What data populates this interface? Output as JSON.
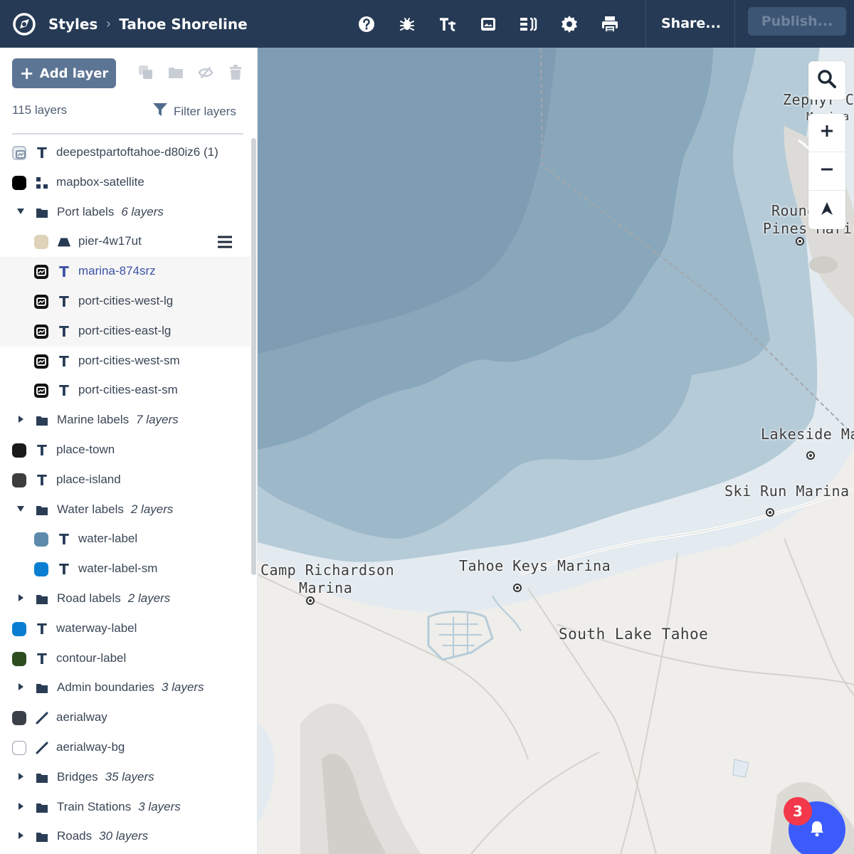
{
  "header": {
    "breadcrumb_root": "Styles",
    "breadcrumb_sep": "›",
    "title": "Tahoe Shoreline",
    "share_label": "Share...",
    "publish_label": "Publish...",
    "toolbar_icons": [
      "help-icon",
      "debug-icon",
      "typography-icon",
      "images-icon",
      "layers-json-icon",
      "settings-icon",
      "print-icon"
    ]
  },
  "sidebar": {
    "add_layer_label": "Add layer",
    "layer_count": "115 layers",
    "filter_label": "Filter layers",
    "tools": [
      "duplicate-icon",
      "group-icon",
      "hide-icon",
      "delete-icon"
    ],
    "layers": [
      {
        "name": "deepestpartoftahoe-d80iz6 (1)",
        "kind": "symbol",
        "indent": 0,
        "swatch": "#e8edf2",
        "swatch_kind": "image"
      },
      {
        "name": "mapbox-satellite",
        "kind": "raster",
        "indent": 0,
        "swatch": "#000000"
      },
      {
        "name": "Port labels",
        "count": "6 layers",
        "kind": "group",
        "indent": 0,
        "expanded": true
      },
      {
        "name": "pier-4w17ut",
        "kind": "fill-extrusion",
        "indent": 1,
        "swatch": "#ded3b8",
        "menu": true
      },
      {
        "name": "marina-874srz",
        "kind": "symbol",
        "indent": 1,
        "swatch_kind": "image",
        "selected": true
      },
      {
        "name": "port-cities-west-lg",
        "kind": "symbol",
        "indent": 1,
        "swatch_kind": "image"
      },
      {
        "name": "port-cities-east-lg",
        "kind": "symbol",
        "indent": 1,
        "swatch_kind": "image"
      },
      {
        "name": "port-cities-west-sm",
        "kind": "symbol",
        "indent": 1,
        "swatch_kind": "image"
      },
      {
        "name": "port-cities-east-sm",
        "kind": "symbol",
        "indent": 1,
        "swatch_kind": "image"
      },
      {
        "name": "Marine labels",
        "count": "7 layers",
        "kind": "group",
        "indent": 0,
        "expanded": false
      },
      {
        "name": "place-town",
        "kind": "symbol",
        "indent": 0,
        "swatch": "#1a1a1a"
      },
      {
        "name": "place-island",
        "kind": "symbol",
        "indent": 0,
        "swatch": "#3d3d3d"
      },
      {
        "name": "Water labels",
        "count": "2 layers",
        "kind": "group",
        "indent": 0,
        "expanded": true
      },
      {
        "name": "water-label",
        "kind": "symbol",
        "indent": 1,
        "swatch": "#5d8aaa"
      },
      {
        "name": "water-label-sm",
        "kind": "symbol",
        "indent": 1,
        "swatch": "#0a7fd1"
      },
      {
        "name": "Road labels",
        "count": "2 layers",
        "kind": "group",
        "indent": 0,
        "expanded": false
      },
      {
        "name": "waterway-label",
        "kind": "symbol",
        "indent": 0,
        "swatch": "#0a7fd1"
      },
      {
        "name": "contour-label",
        "kind": "symbol",
        "indent": 0,
        "swatch": "#2d4d1f"
      },
      {
        "name": "Admin boundaries",
        "count": "3 layers",
        "kind": "group",
        "indent": 0,
        "expanded": false
      },
      {
        "name": "aerialway",
        "kind": "line",
        "indent": 0,
        "swatch": "#3b3f47"
      },
      {
        "name": "aerialway-bg",
        "kind": "line",
        "indent": 0,
        "swatch": "#ffffff"
      },
      {
        "name": "Bridges",
        "count": "35 layers",
        "kind": "group",
        "indent": 0,
        "expanded": false
      },
      {
        "name": "Train Stations",
        "count": "3 layers",
        "kind": "group",
        "indent": 0,
        "expanded": false
      },
      {
        "name": "Roads",
        "count": "30 layers",
        "kind": "group",
        "indent": 0,
        "expanded": false
      }
    ]
  },
  "map": {
    "labels": {
      "zephyr": "Zephyr C",
      "zephyr2": "M rina",
      "round": "Round  Ll",
      "pines": "Pines Marir",
      "lakeside": "Lakeside Ma",
      "skirun": "Ski Run Marina",
      "camp1": "Camp Richardson",
      "camp2": "Marina",
      "keys": "Tahoe Keys Marina",
      "southlake": "South Lake Tahoe"
    },
    "controls": [
      "search-icon",
      "zoom-in-icon",
      "zoom-out-icon",
      "compass-icon"
    ]
  },
  "notifications": {
    "count": "3"
  },
  "colors": {
    "header_bg": "#263a55",
    "water_deep": "#7f9db2",
    "water_mid": "#8eaec1",
    "water_shallow": "#b6cbd8",
    "water_shore": "#e3ebf0",
    "land": "#efeeeb",
    "accent": "#3b5bfd",
    "badge": "#f2384a"
  }
}
